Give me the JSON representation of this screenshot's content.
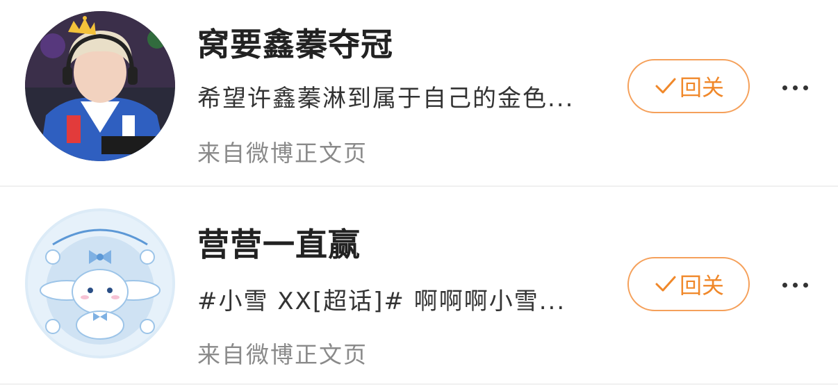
{
  "colors": {
    "accent": "#f0882a",
    "accent_border": "#f5a05a",
    "name_text": "#222222",
    "snippet_text": "#333333",
    "source_text": "#8a8a8a",
    "divider": "#f0f0f0"
  },
  "items": [
    {
      "name": "窝要鑫蓁夺冠",
      "snippet": "希望许鑫蓁淋到属于自己的金色...",
      "source": "来自微博正文页",
      "follow_icon": "check-icon",
      "follow_label": "回关",
      "more_icon": "more-icon",
      "avatar_icon": "avatar-photo-gamer"
    },
    {
      "name": "营营一直赢",
      "snippet": "#小雪 XX[超话]# 啊啊啊小雪...",
      "source": "来自微博正文页",
      "follow_icon": "check-icon",
      "follow_label": "回关",
      "more_icon": "more-icon",
      "avatar_icon": "avatar-cinnamoroll"
    }
  ]
}
